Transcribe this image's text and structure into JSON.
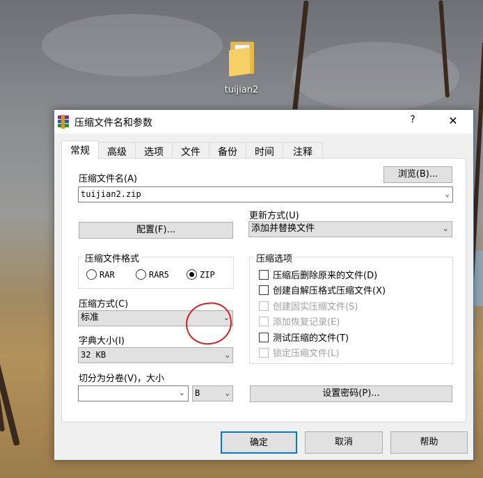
{
  "desktop": {
    "icon_label": "tuijian2"
  },
  "dialog": {
    "title": "压缩文件名和参数",
    "help": "?",
    "close": "✕",
    "tabs": [
      "常规",
      "高级",
      "选项",
      "文件",
      "备份",
      "时间",
      "注释"
    ],
    "archive_name_label": "压缩文件名(A)",
    "browse_button": "浏览(B)...",
    "archive_name_value": "tuijian2.zip",
    "update_mode_label": "更新方式(U)",
    "update_mode_value": "添加并替换文件",
    "profiles_button": "配置(F)...",
    "format_group_title": "压缩文件格式",
    "formats": [
      {
        "label": "RAR",
        "selected": false
      },
      {
        "label": "RAR5",
        "selected": false
      },
      {
        "label": "ZIP",
        "selected": true
      }
    ],
    "method_label": "压缩方式(C)",
    "method_value": "标准",
    "dict_label": "字典大小(I)",
    "dict_value": "32 KB",
    "split_label": "切分为分卷(V)，大小",
    "split_value": "",
    "split_unit": "B",
    "options_group_title": "压缩选项",
    "options": [
      {
        "label": "压缩后删除原来的文件(D)",
        "enabled": true,
        "checked": false
      },
      {
        "label": "创建自解压格式压缩文件(X)",
        "enabled": true,
        "checked": false
      },
      {
        "label": "创建固实压缩文件(S)",
        "enabled": false,
        "checked": false
      },
      {
        "label": "添加恢复记录(E)",
        "enabled": false,
        "checked": false
      },
      {
        "label": "测试压缩的文件(T)",
        "enabled": true,
        "checked": false
      },
      {
        "label": "锁定压缩文件(L)",
        "enabled": false,
        "checked": false
      }
    ],
    "password_button": "设置密码(P)...",
    "ok_button": "确定",
    "cancel_button": "取消",
    "help_button": "帮助"
  },
  "colors": {
    "highlight_circle": "#d62020",
    "default_button_border": "#0078d7"
  }
}
